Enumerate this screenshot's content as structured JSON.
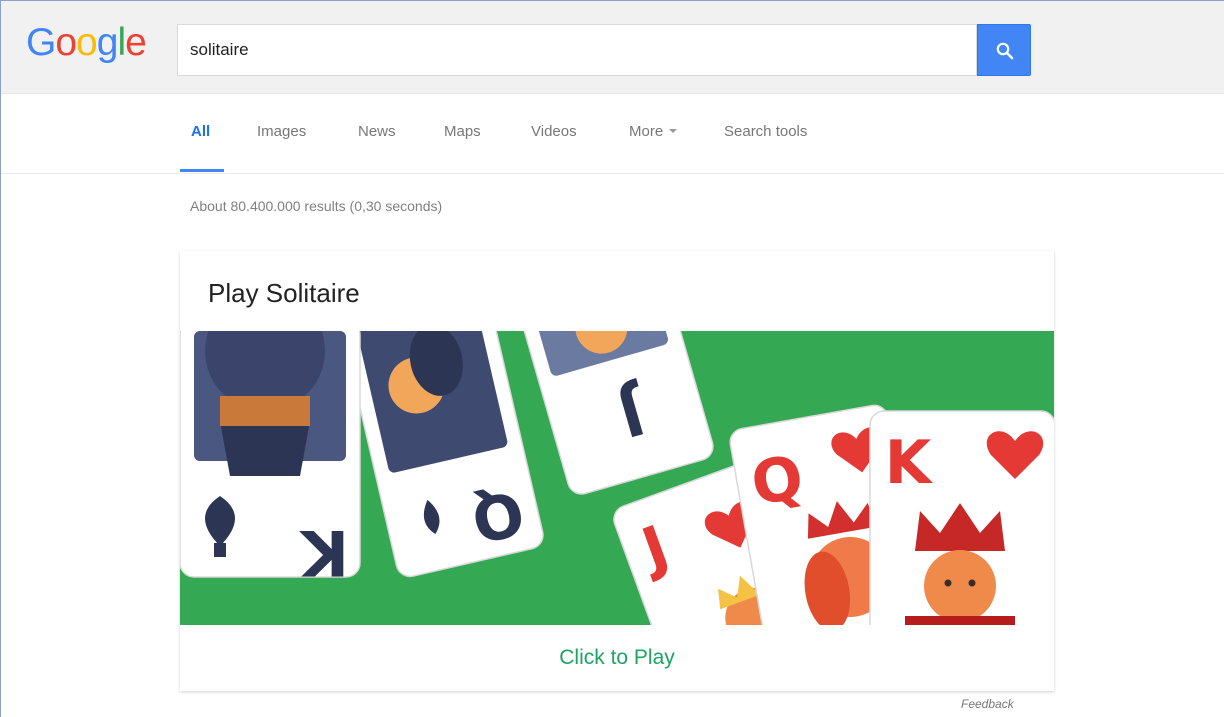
{
  "colors": {
    "header_bg": "#f1f1f1",
    "accent_blue": "#4285f4",
    "table_green": "#34a853",
    "play_link": "#1da462",
    "card_navy": "#2d3555",
    "card_red": "#e53935"
  },
  "logo": {
    "letters": [
      "G",
      "o",
      "o",
      "g",
      "l",
      "e"
    ],
    "colors": [
      "#4285f4",
      "#ea4335",
      "#fbbc05",
      "#4285f4",
      "#34a853",
      "#ea4335"
    ]
  },
  "search": {
    "query": "solitaire",
    "button_icon": "search-icon"
  },
  "tabs": [
    {
      "label": "All",
      "active": true
    },
    {
      "label": "Images",
      "active": false
    },
    {
      "label": "News",
      "active": false
    },
    {
      "label": "Maps",
      "active": false
    },
    {
      "label": "Videos",
      "active": false
    },
    {
      "label": "More",
      "active": false,
      "has_dropdown": true
    },
    {
      "label": "Search tools",
      "active": false
    }
  ],
  "results": {
    "stats": "About 80.400.000 results (0,30 seconds)"
  },
  "game_card": {
    "title": "Play Solitaire",
    "play_label": "Click to Play",
    "cards": [
      {
        "rank": "K",
        "suit": "spades",
        "face_color": "navy"
      },
      {
        "rank": "Q",
        "suit": "spades",
        "face_color": "navy"
      },
      {
        "rank": "J",
        "suit": "spades",
        "face_color": "navy"
      },
      {
        "rank": "J",
        "suit": "hearts",
        "face_color": "red"
      },
      {
        "rank": "Q",
        "suit": "hearts",
        "face_color": "red"
      },
      {
        "rank": "K",
        "suit": "hearts",
        "face_color": "red"
      }
    ]
  },
  "footer": {
    "feedback_label": "Feedback"
  }
}
